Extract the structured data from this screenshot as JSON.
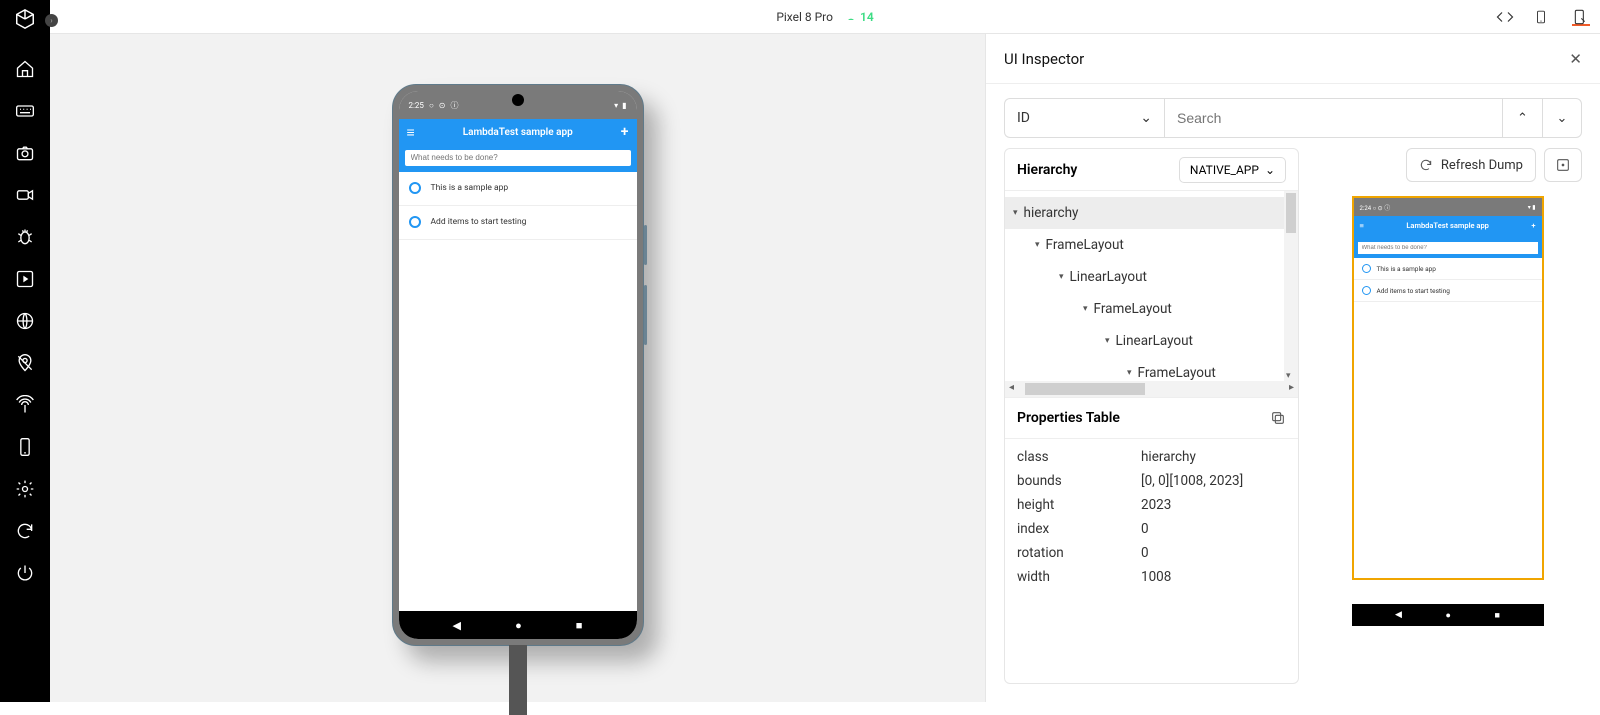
{
  "topbar": {
    "device_name": "Pixel 8 Pro",
    "os_version": "14"
  },
  "sidebar": {
    "icons": [
      "home",
      "keyboard",
      "camera",
      "video",
      "bug",
      "play-square",
      "globe",
      "location-off",
      "broadcast",
      "mobile",
      "settings",
      "sync",
      "power"
    ]
  },
  "phone": {
    "status_time": "2:25",
    "app_title": "LambdaTest sample app",
    "input_placeholder": "What needs to be done?",
    "items": [
      {
        "label": "This is a sample app"
      },
      {
        "label": "Add items to start testing"
      }
    ]
  },
  "inspector": {
    "title": "UI Inspector",
    "search_by_label": "ID",
    "search_placeholder": "Search",
    "hierarchy_label": "Hierarchy",
    "hierarchy_context": "NATIVE_APP",
    "refresh_label": "Refresh Dump",
    "tree": [
      {
        "depth": 0,
        "label": "hierarchy",
        "selected": true
      },
      {
        "depth": 1,
        "label": "FrameLayout"
      },
      {
        "depth": 2,
        "label": "LinearLayout"
      },
      {
        "depth": 3,
        "label": "FrameLayout"
      },
      {
        "depth": 4,
        "label": "LinearLayout"
      },
      {
        "depth": 5,
        "label": "FrameLayout"
      }
    ],
    "properties_label": "Properties Table",
    "properties": [
      {
        "k": "class",
        "v": "hierarchy"
      },
      {
        "k": "bounds",
        "v": "[0, 0][1008, 2023]"
      },
      {
        "k": "height",
        "v": "2023"
      },
      {
        "k": "index",
        "v": "0"
      },
      {
        "k": "rotation",
        "v": "0"
      },
      {
        "k": "width",
        "v": "1008"
      }
    ]
  },
  "preview": {
    "status_time": "2:24",
    "app_title": "LambdaTest sample app",
    "input_placeholder": "What needs to be done?",
    "items": [
      {
        "label": "This is a sample app"
      },
      {
        "label": "Add items to start testing"
      }
    ]
  }
}
